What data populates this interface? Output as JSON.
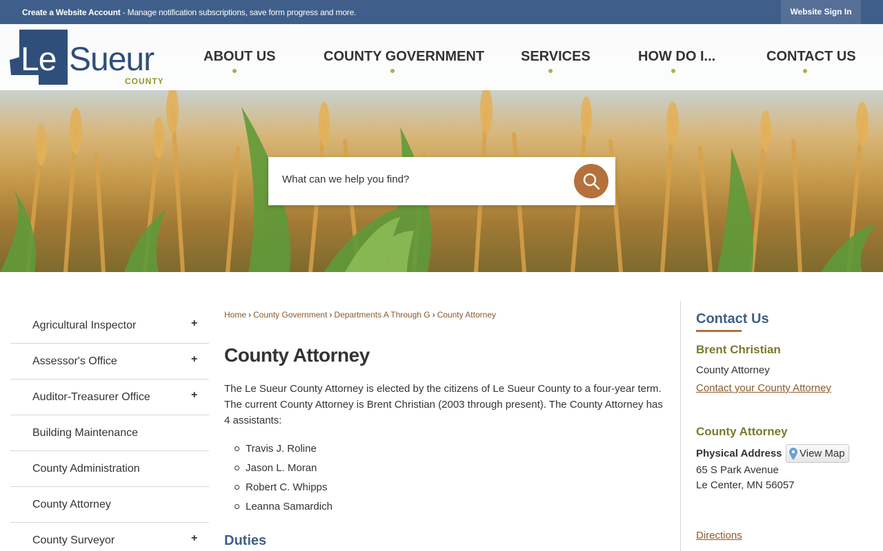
{
  "topbar": {
    "account_link": "Create a Website Account",
    "account_desc": " - Manage notification subscriptions, save form progress and more.",
    "signin": "Website Sign In"
  },
  "logo": {
    "le": "Le",
    "sueur": "Sueur",
    "county": "COUNTY"
  },
  "nav": [
    {
      "label": "ABOUT US"
    },
    {
      "label": "COUNTY GOVERNMENT"
    },
    {
      "label": "SERVICES"
    },
    {
      "label": "HOW DO I..."
    },
    {
      "label": "CONTACT US"
    }
  ],
  "search": {
    "placeholder": "What can we help you find?"
  },
  "sidenav": [
    {
      "label": "Agricultural Inspector",
      "expand": "+"
    },
    {
      "label": "Assessor's Office",
      "expand": "+"
    },
    {
      "label": "Auditor-Treasurer Office",
      "expand": "+"
    },
    {
      "label": "Building Maintenance",
      "expand": ""
    },
    {
      "label": "County Administration",
      "expand": ""
    },
    {
      "label": "County Attorney",
      "expand": ""
    },
    {
      "label": "County Surveyor",
      "expand": "+"
    }
  ],
  "breadcrumb": [
    "Home",
    "County Government",
    "Departments A Through G",
    "County Attorney"
  ],
  "main": {
    "title": "County Attorney",
    "intro": "The Le Sueur County Attorney is elected by the citizens of Le Sueur County to a four-year term. The current County Attorney is Brent Christian (2003 through present). The County Attorney has 4 assistants:",
    "assistants": [
      "Travis J. Roline",
      "Jason L. Moran",
      "Robert C. Whipps",
      "Leanna Samardich"
    ],
    "duties_heading": "Duties"
  },
  "contact": {
    "heading": "Contact Us",
    "name": "Brent Christian",
    "role": "County Attorney",
    "contact_link": "Contact your County Attorney",
    "dept_heading": "County Attorney",
    "address_label": "Physical Address",
    "view_map": "View Map",
    "street": "65 S Park Avenue",
    "city": "Le Center, MN 56057",
    "directions": "Directions"
  },
  "colors": {
    "brand_blue": "#3f5f8a",
    "accent_orange": "#b5703c",
    "accent_olive": "#7a7a2a",
    "nav_dot": "#a6b24a"
  }
}
